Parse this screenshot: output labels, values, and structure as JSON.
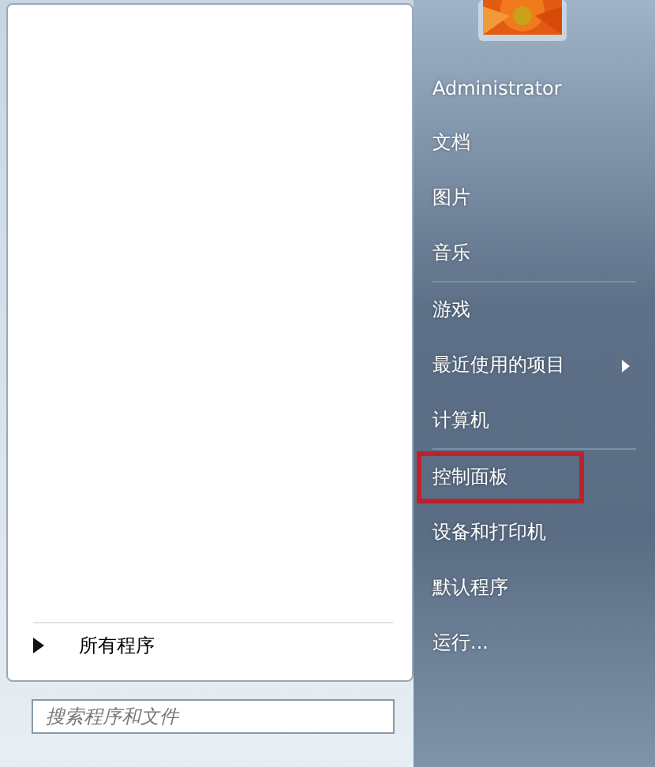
{
  "programs": {
    "all_programs": "所有程序"
  },
  "search": {
    "placeholder": "搜索程序和文件"
  },
  "user": {
    "picture": {
      "kind": "picture"
    }
  },
  "places": [
    [
      {
        "label": "Administrator",
        "has_submenu": false,
        "highlighted": false
      },
      {
        "label": "文档",
        "has_submenu": false,
        "highlighted": false
      },
      {
        "label": "图片",
        "has_submenu": false,
        "highlighted": false
      },
      {
        "label": "音乐",
        "has_submenu": false,
        "highlighted": false
      }
    ],
    [
      {
        "label": "游戏",
        "has_submenu": false,
        "highlighted": false
      },
      {
        "label": "最近使用的项目",
        "has_submenu": true,
        "highlighted": false
      },
      {
        "label": "计算机",
        "has_submenu": false,
        "highlighted": false
      }
    ],
    [
      {
        "label": "控制面板",
        "has_submenu": false,
        "highlighted": true
      },
      {
        "label": "设备和打印机",
        "has_submenu": false,
        "highlighted": false
      },
      {
        "label": "默认程序",
        "has_submenu": false,
        "highlighted": false
      },
      {
        "label": "运行...",
        "has_submenu": false,
        "highlighted": false
      }
    ]
  ]
}
